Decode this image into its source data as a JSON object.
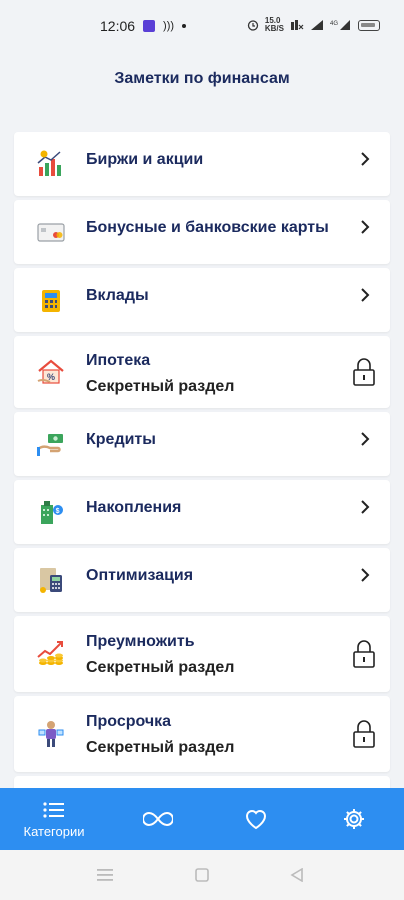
{
  "status_bar": {
    "time": "12:06",
    "net_speed": "15.0\nKB/S",
    "icons": [
      "app-notification-icon",
      "cast-icon",
      "alarm-icon",
      "no-sim-icon",
      "signal-icon",
      "wifi-icon",
      "battery-icon"
    ]
  },
  "header": {
    "title": "Заметки по финансам"
  },
  "categories": [
    {
      "label": "Биржи и акции",
      "secret": false,
      "icon": "stocks-chart-icon"
    },
    {
      "label": "Бонусные и банковские карты",
      "secret": false,
      "icon": "bank-card-icon"
    },
    {
      "label": "Вклады",
      "secret": false,
      "icon": "deposit-calculator-icon"
    },
    {
      "label": "Ипотека",
      "subtitle": "Секретный раздел",
      "secret": true,
      "icon": "mortgage-house-icon"
    },
    {
      "label": "Кредиты",
      "secret": false,
      "icon": "credit-hand-money-icon"
    },
    {
      "label": "Накопления",
      "secret": false,
      "icon": "savings-icon"
    },
    {
      "label": "Оптимизация",
      "secret": false,
      "icon": "optimization-calculator-icon"
    },
    {
      "label": "Преумножить",
      "subtitle": "Секретный раздел",
      "secret": true,
      "icon": "multiply-growth-icon"
    },
    {
      "label": "Просрочка",
      "subtitle": "Секретный раздел",
      "secret": true,
      "icon": "overdue-person-icon"
    }
  ],
  "bottom_nav": {
    "categories_label": "Категории",
    "items": [
      "list-icon",
      "infinity-icon",
      "heart-icon",
      "gear-icon"
    ]
  },
  "colors": {
    "accent": "#2d8ef1",
    "title": "#1b2a5e",
    "background": "#f1f3f6"
  }
}
